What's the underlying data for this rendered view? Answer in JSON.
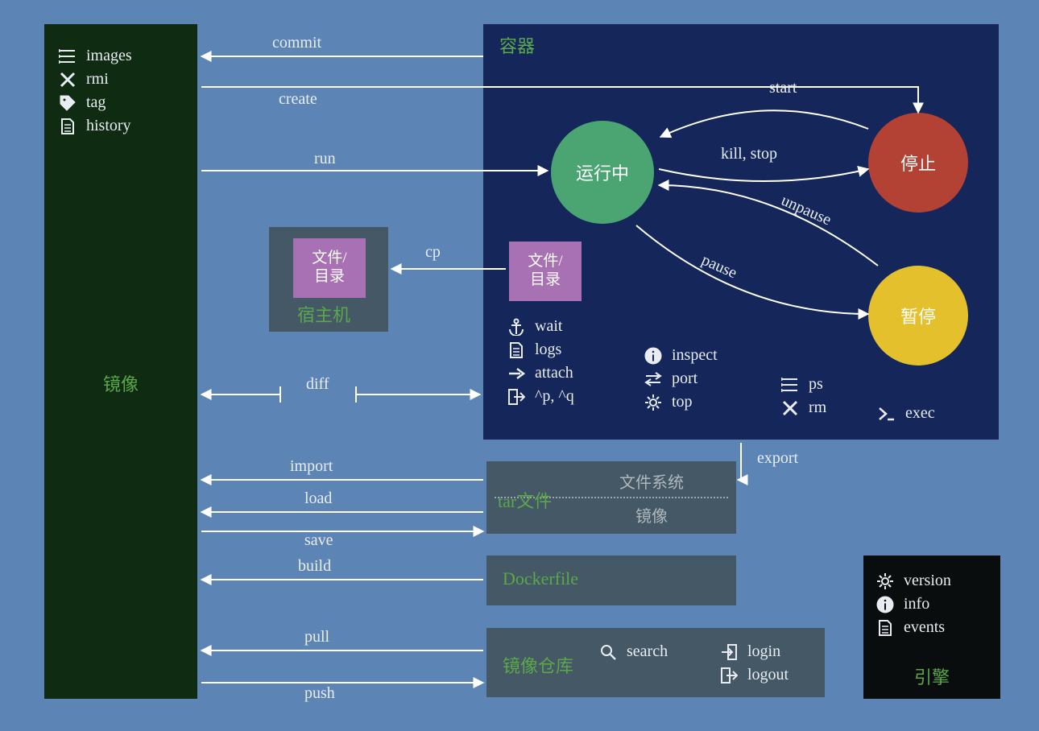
{
  "images_panel": {
    "title": "镜像",
    "items": [
      {
        "icon": "list-icon",
        "label": "images"
      },
      {
        "icon": "x-icon",
        "label": "rmi"
      },
      {
        "icon": "tag-icon",
        "label": "tag"
      },
      {
        "icon": "file-icon",
        "label": "history"
      }
    ]
  },
  "host_panel": {
    "title": "宿主机",
    "file_tile": "文件/\n目录"
  },
  "container_panel": {
    "title": "容器",
    "file_tile": "文件/\n目录",
    "states": {
      "running": "运行中",
      "stopped": "停止",
      "paused": "暂停"
    },
    "cmds_col1": [
      {
        "icon": "anchor-icon",
        "label": "wait"
      },
      {
        "icon": "file-icon",
        "label": "logs"
      },
      {
        "icon": "arrow-right-icon",
        "label": "attach"
      },
      {
        "icon": "exit-icon",
        "label": "^p, ^q"
      }
    ],
    "cmds_col2": [
      {
        "icon": "info-icon",
        "label": "inspect"
      },
      {
        "icon": "swap-icon",
        "label": "port"
      },
      {
        "icon": "gears-icon",
        "label": "top"
      }
    ],
    "cmds_col3": [
      {
        "icon": "list-icon",
        "label": "ps"
      },
      {
        "icon": "x-icon",
        "label": "rm"
      }
    ],
    "cmds_col4": [
      {
        "icon": "prompt-icon",
        "label": "exec"
      }
    ]
  },
  "tar_box": {
    "label": "tar文件",
    "fs": "文件系统",
    "img": "镜像"
  },
  "dockerfile_box": {
    "label": "Dockerfile"
  },
  "registry_box": {
    "label": "镜像仓库",
    "cmds": [
      {
        "icon": "search-icon",
        "label": "search"
      },
      {
        "icon": "login-icon",
        "label": "login"
      },
      {
        "icon": "logout-icon",
        "label": "logout"
      }
    ]
  },
  "engine_box": {
    "title": "引擎",
    "cmds": [
      {
        "icon": "gear-icon",
        "label": "version"
      },
      {
        "icon": "info-icon",
        "label": "info"
      },
      {
        "icon": "file-icon",
        "label": "events"
      }
    ]
  },
  "edges": {
    "commit": "commit",
    "create": "create",
    "run": "run",
    "cp": "cp",
    "start": "start",
    "kill_stop": "kill, stop",
    "unpause": "unpause",
    "pause": "pause",
    "diff": "diff",
    "import": "import",
    "export": "export",
    "load": "load",
    "save": "save",
    "build": "build",
    "pull": "pull",
    "push": "push"
  }
}
